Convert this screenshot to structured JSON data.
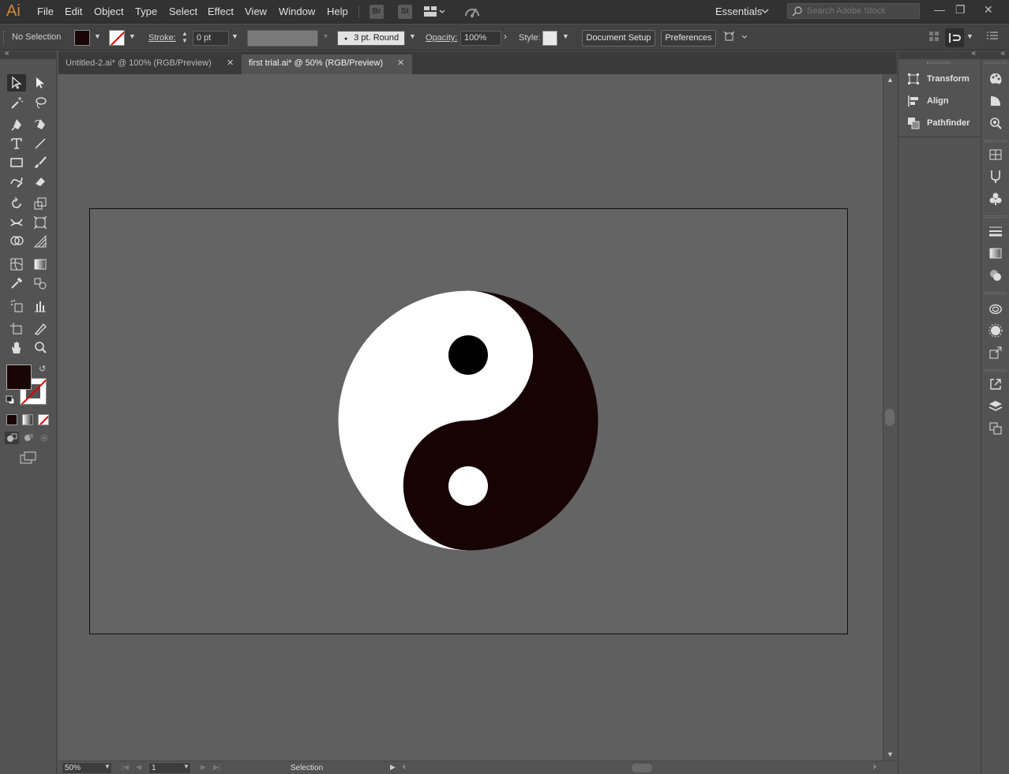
{
  "app": {
    "logo": "Ai"
  },
  "menu": [
    "File",
    "Edit",
    "Object",
    "Type",
    "Select",
    "Effect",
    "View",
    "Window",
    "Help"
  ],
  "menu_buttons": {
    "bridge": "Br",
    "stock": "St"
  },
  "workspace": "Essentials",
  "search": {
    "placeholder": "Search Adobe Stock"
  },
  "control_bar": {
    "selection_status": "No Selection",
    "fill_color": "#1a0505",
    "stroke_label": "Stroke:",
    "stroke_value": "0 pt",
    "brush_value": "3 pt. Round",
    "opacity_label": "Opacity:",
    "opacity_value": "100%",
    "style_label": "Style:",
    "document_setup": "Document Setup",
    "preferences": "Preferences"
  },
  "tabs": [
    {
      "label": "Untitled-2.ai* @ 100% (RGB/Preview)",
      "active": false
    },
    {
      "label": "first trial.ai* @ 50% (RGB/Preview)",
      "active": true
    }
  ],
  "artwork": {
    "dark_color": "#170303",
    "light_color": "#ffffff",
    "top_dot_color": "#000000",
    "bottom_dot_color": "#ffffff"
  },
  "status": {
    "zoom": "50%",
    "artboard": "1",
    "tool": "Selection"
  },
  "panels": [
    {
      "label": "Transform",
      "icon": "transform-icon"
    },
    {
      "label": "Align",
      "icon": "align-icon"
    },
    {
      "label": "Pathfinder",
      "icon": "pathfinder-icon"
    }
  ]
}
